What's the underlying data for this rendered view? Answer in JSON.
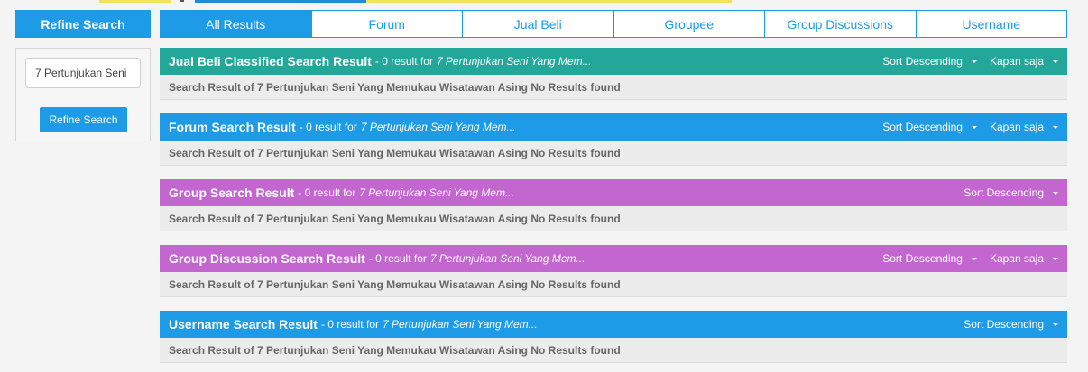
{
  "sidebar": {
    "refine_title": "Refine Search",
    "search_value": "7 Pertunjukan Seni",
    "submit_label": "Refine Search"
  },
  "tabs": [
    "All Results",
    "Forum",
    "Jual Beli",
    "Groupee",
    "Group Discussions",
    "Username"
  ],
  "panels": [
    {
      "title": "Jual Beli Classified Search Result",
      "count": "- 0 result for",
      "query": "7 Pertunjukan Seni Yang Mem...",
      "sort": "Sort Descending",
      "time": "Kapan saja",
      "body": "Search Result of 7 Pertunjukan Seni Yang Memukau Wisatawan Asing No Results found"
    },
    {
      "title": "Forum Search Result",
      "count": "- 0 result for",
      "query": "7 Pertunjukan Seni Yang Mem...",
      "sort": "Sort Descending",
      "time": "Kapan saja",
      "body": "Search Result of 7 Pertunjukan Seni Yang Memukau Wisatawan Asing No Results found"
    },
    {
      "title": "Group Search Result",
      "count": "- 0 result for",
      "query": "7 Pertunjukan Seni Yang Mem...",
      "sort": "Sort Descending",
      "body": "Search Result of 7 Pertunjukan Seni Yang Memukau Wisatawan Asing No Results found"
    },
    {
      "title": "Group Discussion Search Result",
      "count": "- 0 result for",
      "query": "7 Pertunjukan Seni Yang Mem...",
      "sort": "Sort Descending",
      "time": "Kapan saja",
      "body": "Search Result of 7 Pertunjukan Seni Yang Memukau Wisatawan Asing No Results found"
    },
    {
      "title": "Username Search Result",
      "count": "- 0 result for",
      "query": "7 Pertunjukan Seni Yang Mem...",
      "sort": "Sort Descending",
      "body": "Search Result of 7 Pertunjukan Seni Yang Memukau Wisatawan Asing No Results found"
    }
  ],
  "colors": {
    "primary": "#1e9be6",
    "classified": "#22a79a",
    "group": "#c366d0"
  }
}
